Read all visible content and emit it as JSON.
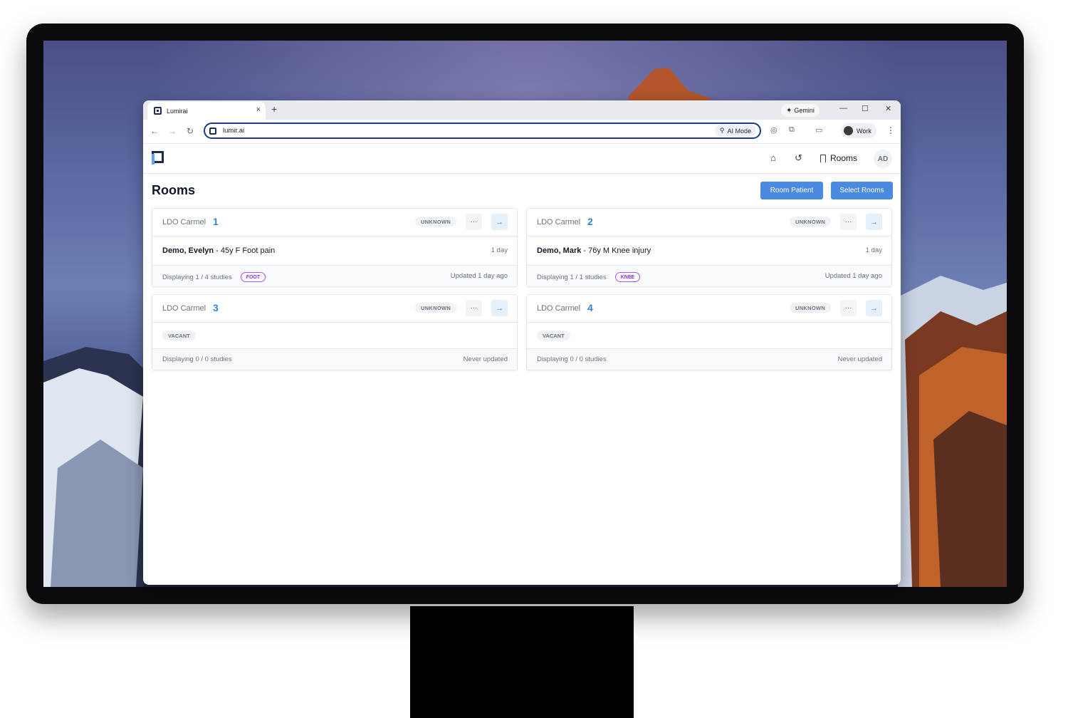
{
  "browser": {
    "tab_title": "Lumirai",
    "tab_close": "×",
    "new_tab": "+",
    "gemini_label": "Gemini",
    "url": "lumir.ai",
    "ai_mode_label": "AI Mode",
    "profile_label": "Work",
    "window_controls": {
      "minimize": "—",
      "maximize": "☐",
      "close": "✕"
    },
    "nav": {
      "back": "←",
      "forward": "→",
      "reload": "↻"
    }
  },
  "app": {
    "nav": {
      "home_icon": "home-icon",
      "history_icon": "history-icon",
      "rooms_label": "Rooms",
      "avatar_initials": "AD"
    },
    "page_title": "Rooms",
    "actions": {
      "room_patient": "Room Patient",
      "select_rooms": "Select Rooms"
    },
    "rooms": [
      {
        "location": "LDO Carmel",
        "number": "1",
        "status": "UNKNOWN",
        "patient_name": "Demo, Evelyn",
        "patient_desc": "- 45y F Foot pain",
        "time": "1 day",
        "studies": "Displaying 1 / 4 studies",
        "tag": "FOOT",
        "updated": "Updated 1 day ago"
      },
      {
        "location": "LDO Carmel",
        "number": "2",
        "status": "UNKNOWN",
        "patient_name": "Demo, Mark",
        "patient_desc": "- 76y M Knee injury",
        "time": "1 day",
        "studies": "Displaying 1 / 1 studies",
        "tag": "KNEE",
        "updated": "Updated 1 day ago"
      },
      {
        "location": "LDO Carmel",
        "number": "3",
        "status": "UNKNOWN",
        "vacant_label": "VACANT",
        "studies": "Displaying 0 / 0 studies",
        "updated": "Never updated"
      },
      {
        "location": "LDO Carmel",
        "number": "4",
        "status": "UNKNOWN",
        "vacant_label": "VACANT",
        "studies": "Displaying 0 / 0 studies",
        "updated": "Never updated"
      }
    ],
    "card_more": "···",
    "card_go": "→"
  },
  "colors": {
    "primary_button": "#4a8ae0",
    "room_number": "#3b82c4",
    "tag_purple": "#9333ea",
    "logo_dark": "#1e2a52",
    "logo_accent": "#60a5fa"
  }
}
